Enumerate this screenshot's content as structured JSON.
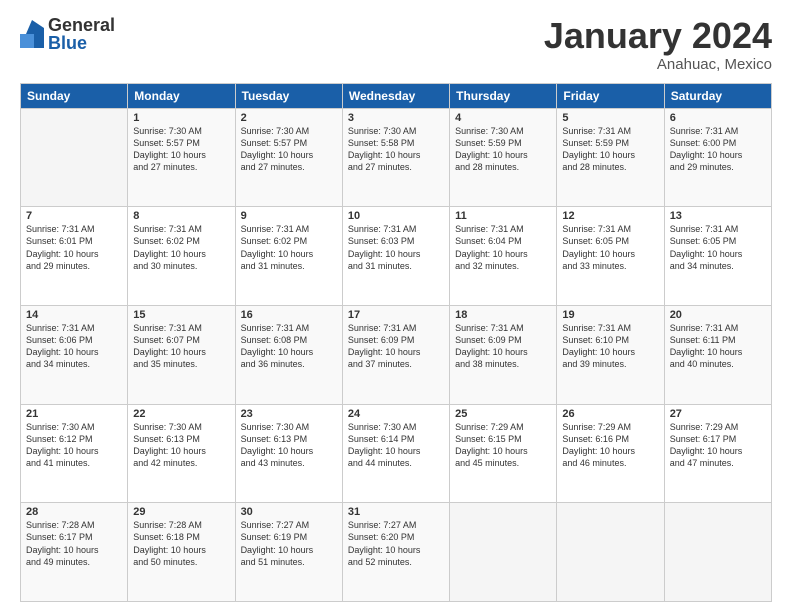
{
  "header": {
    "logo_general": "General",
    "logo_blue": "Blue",
    "month_title": "January 2024",
    "subtitle": "Anahuac, Mexico"
  },
  "days_of_week": [
    "Sunday",
    "Monday",
    "Tuesday",
    "Wednesday",
    "Thursday",
    "Friday",
    "Saturday"
  ],
  "weeks": [
    [
      {
        "day": "",
        "info": ""
      },
      {
        "day": "1",
        "info": "Sunrise: 7:30 AM\nSunset: 5:57 PM\nDaylight: 10 hours\nand 27 minutes."
      },
      {
        "day": "2",
        "info": "Sunrise: 7:30 AM\nSunset: 5:57 PM\nDaylight: 10 hours\nand 27 minutes."
      },
      {
        "day": "3",
        "info": "Sunrise: 7:30 AM\nSunset: 5:58 PM\nDaylight: 10 hours\nand 27 minutes."
      },
      {
        "day": "4",
        "info": "Sunrise: 7:30 AM\nSunset: 5:59 PM\nDaylight: 10 hours\nand 28 minutes."
      },
      {
        "day": "5",
        "info": "Sunrise: 7:31 AM\nSunset: 5:59 PM\nDaylight: 10 hours\nand 28 minutes."
      },
      {
        "day": "6",
        "info": "Sunrise: 7:31 AM\nSunset: 6:00 PM\nDaylight: 10 hours\nand 29 minutes."
      }
    ],
    [
      {
        "day": "7",
        "info": "Sunrise: 7:31 AM\nSunset: 6:01 PM\nDaylight: 10 hours\nand 29 minutes."
      },
      {
        "day": "8",
        "info": "Sunrise: 7:31 AM\nSunset: 6:02 PM\nDaylight: 10 hours\nand 30 minutes."
      },
      {
        "day": "9",
        "info": "Sunrise: 7:31 AM\nSunset: 6:02 PM\nDaylight: 10 hours\nand 31 minutes."
      },
      {
        "day": "10",
        "info": "Sunrise: 7:31 AM\nSunset: 6:03 PM\nDaylight: 10 hours\nand 31 minutes."
      },
      {
        "day": "11",
        "info": "Sunrise: 7:31 AM\nSunset: 6:04 PM\nDaylight: 10 hours\nand 32 minutes."
      },
      {
        "day": "12",
        "info": "Sunrise: 7:31 AM\nSunset: 6:05 PM\nDaylight: 10 hours\nand 33 minutes."
      },
      {
        "day": "13",
        "info": "Sunrise: 7:31 AM\nSunset: 6:05 PM\nDaylight: 10 hours\nand 34 minutes."
      }
    ],
    [
      {
        "day": "14",
        "info": "Sunrise: 7:31 AM\nSunset: 6:06 PM\nDaylight: 10 hours\nand 34 minutes."
      },
      {
        "day": "15",
        "info": "Sunrise: 7:31 AM\nSunset: 6:07 PM\nDaylight: 10 hours\nand 35 minutes."
      },
      {
        "day": "16",
        "info": "Sunrise: 7:31 AM\nSunset: 6:08 PM\nDaylight: 10 hours\nand 36 minutes."
      },
      {
        "day": "17",
        "info": "Sunrise: 7:31 AM\nSunset: 6:09 PM\nDaylight: 10 hours\nand 37 minutes."
      },
      {
        "day": "18",
        "info": "Sunrise: 7:31 AM\nSunset: 6:09 PM\nDaylight: 10 hours\nand 38 minutes."
      },
      {
        "day": "19",
        "info": "Sunrise: 7:31 AM\nSunset: 6:10 PM\nDaylight: 10 hours\nand 39 minutes."
      },
      {
        "day": "20",
        "info": "Sunrise: 7:31 AM\nSunset: 6:11 PM\nDaylight: 10 hours\nand 40 minutes."
      }
    ],
    [
      {
        "day": "21",
        "info": "Sunrise: 7:30 AM\nSunset: 6:12 PM\nDaylight: 10 hours\nand 41 minutes."
      },
      {
        "day": "22",
        "info": "Sunrise: 7:30 AM\nSunset: 6:13 PM\nDaylight: 10 hours\nand 42 minutes."
      },
      {
        "day": "23",
        "info": "Sunrise: 7:30 AM\nSunset: 6:13 PM\nDaylight: 10 hours\nand 43 minutes."
      },
      {
        "day": "24",
        "info": "Sunrise: 7:30 AM\nSunset: 6:14 PM\nDaylight: 10 hours\nand 44 minutes."
      },
      {
        "day": "25",
        "info": "Sunrise: 7:29 AM\nSunset: 6:15 PM\nDaylight: 10 hours\nand 45 minutes."
      },
      {
        "day": "26",
        "info": "Sunrise: 7:29 AM\nSunset: 6:16 PM\nDaylight: 10 hours\nand 46 minutes."
      },
      {
        "day": "27",
        "info": "Sunrise: 7:29 AM\nSunset: 6:17 PM\nDaylight: 10 hours\nand 47 minutes."
      }
    ],
    [
      {
        "day": "28",
        "info": "Sunrise: 7:28 AM\nSunset: 6:17 PM\nDaylight: 10 hours\nand 49 minutes."
      },
      {
        "day": "29",
        "info": "Sunrise: 7:28 AM\nSunset: 6:18 PM\nDaylight: 10 hours\nand 50 minutes."
      },
      {
        "day": "30",
        "info": "Sunrise: 7:27 AM\nSunset: 6:19 PM\nDaylight: 10 hours\nand 51 minutes."
      },
      {
        "day": "31",
        "info": "Sunrise: 7:27 AM\nSunset: 6:20 PM\nDaylight: 10 hours\nand 52 minutes."
      },
      {
        "day": "",
        "info": ""
      },
      {
        "day": "",
        "info": ""
      },
      {
        "day": "",
        "info": ""
      }
    ]
  ]
}
